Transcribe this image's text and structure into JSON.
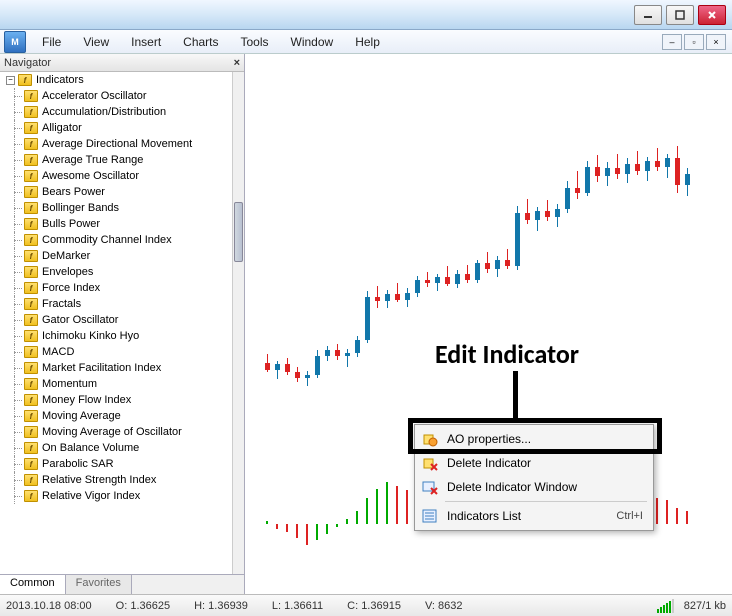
{
  "menu": {
    "file": "File",
    "view": "View",
    "insert": "Insert",
    "charts": "Charts",
    "tools": "Tools",
    "window": "Window",
    "help": "Help"
  },
  "navigator": {
    "title": "Navigator",
    "root": "Indicators",
    "items": [
      "Accelerator Oscillator",
      "Accumulation/Distribution",
      "Alligator",
      "Average Directional Movement",
      "Average True Range",
      "Awesome Oscillator",
      "Bears Power",
      "Bollinger Bands",
      "Bulls Power",
      "Commodity Channel Index",
      "DeMarker",
      "Envelopes",
      "Force Index",
      "Fractals",
      "Gator Oscillator",
      "Ichimoku Kinko Hyo",
      "MACD",
      "Market Facilitation Index",
      "Momentum",
      "Money Flow Index",
      "Moving Average",
      "Moving Average of Oscillator",
      "On Balance Volume",
      "Parabolic SAR",
      "Relative Strength Index",
      "Relative Vigor Index"
    ],
    "tabs": {
      "common": "Common",
      "favorites": "Favorites"
    }
  },
  "context_menu": {
    "properties": "AO properties...",
    "delete_ind": "Delete Indicator",
    "delete_win": "Delete Indicator Window",
    "list": "Indicators List",
    "list_shortcut": "Ctrl+I"
  },
  "annotation": "Edit Indicator",
  "status": {
    "datetime": "2013.10.18 08:00",
    "open_label": "O:",
    "open": "1.36625",
    "high_label": "H:",
    "high": "1.36939",
    "low_label": "L:",
    "low": "1.36611",
    "close_label": "C:",
    "close": "1.36915",
    "vol_label": "V:",
    "vol": "8632",
    "traffic": "827/1 kb"
  },
  "chart_data": {
    "type": "candlestick",
    "title": "",
    "indicator_subwindow": "Awesome Oscillator",
    "candles": [
      {
        "x": 0,
        "o": 1,
        "h": 7,
        "l": -6,
        "c": -4,
        "dir": "r"
      },
      {
        "x": 1,
        "o": -4,
        "h": 2,
        "l": -11,
        "c": 0,
        "dir": "b"
      },
      {
        "x": 2,
        "o": 0,
        "h": 4,
        "l": -8,
        "c": -6,
        "dir": "r"
      },
      {
        "x": 3,
        "o": -6,
        "h": -2,
        "l": -13,
        "c": -10,
        "dir": "r"
      },
      {
        "x": 4,
        "o": -10,
        "h": -5,
        "l": -16,
        "c": -8,
        "dir": "b"
      },
      {
        "x": 5,
        "o": -8,
        "h": 10,
        "l": -10,
        "c": 6,
        "dir": "b"
      },
      {
        "x": 6,
        "o": 6,
        "h": 13,
        "l": 2,
        "c": 10,
        "dir": "b"
      },
      {
        "x": 7,
        "o": 10,
        "h": 14,
        "l": 3,
        "c": 6,
        "dir": "r"
      },
      {
        "x": 8,
        "o": 6,
        "h": 11,
        "l": -2,
        "c": 8,
        "dir": "b"
      },
      {
        "x": 9,
        "o": 8,
        "h": 20,
        "l": 5,
        "c": 17,
        "dir": "b"
      },
      {
        "x": 10,
        "o": 17,
        "h": 52,
        "l": 15,
        "c": 48,
        "dir": "b"
      },
      {
        "x": 11,
        "o": 48,
        "h": 56,
        "l": 40,
        "c": 45,
        "dir": "r"
      },
      {
        "x": 12,
        "o": 45,
        "h": 53,
        "l": 40,
        "c": 50,
        "dir": "b"
      },
      {
        "x": 13,
        "o": 50,
        "h": 58,
        "l": 44,
        "c": 46,
        "dir": "r"
      },
      {
        "x": 14,
        "o": 46,
        "h": 54,
        "l": 41,
        "c": 51,
        "dir": "b"
      },
      {
        "x": 15,
        "o": 51,
        "h": 63,
        "l": 48,
        "c": 60,
        "dir": "b"
      },
      {
        "x": 16,
        "o": 60,
        "h": 66,
        "l": 55,
        "c": 58,
        "dir": "r"
      },
      {
        "x": 17,
        "o": 58,
        "h": 64,
        "l": 52,
        "c": 62,
        "dir": "b"
      },
      {
        "x": 18,
        "o": 62,
        "h": 70,
        "l": 56,
        "c": 57,
        "dir": "r"
      },
      {
        "x": 19,
        "o": 57,
        "h": 67,
        "l": 54,
        "c": 64,
        "dir": "b"
      },
      {
        "x": 20,
        "o": 64,
        "h": 71,
        "l": 58,
        "c": 60,
        "dir": "r"
      },
      {
        "x": 21,
        "o": 60,
        "h": 74,
        "l": 58,
        "c": 72,
        "dir": "b"
      },
      {
        "x": 22,
        "o": 72,
        "h": 80,
        "l": 65,
        "c": 68,
        "dir": "r"
      },
      {
        "x": 23,
        "o": 68,
        "h": 77,
        "l": 62,
        "c": 74,
        "dir": "b"
      },
      {
        "x": 24,
        "o": 74,
        "h": 82,
        "l": 68,
        "c": 70,
        "dir": "r"
      },
      {
        "x": 25,
        "o": 70,
        "h": 113,
        "l": 67,
        "c": 108,
        "dir": "b"
      },
      {
        "x": 26,
        "o": 108,
        "h": 118,
        "l": 100,
        "c": 103,
        "dir": "r"
      },
      {
        "x": 27,
        "o": 103,
        "h": 112,
        "l": 95,
        "c": 109,
        "dir": "b"
      },
      {
        "x": 28,
        "o": 109,
        "h": 117,
        "l": 102,
        "c": 105,
        "dir": "r"
      },
      {
        "x": 29,
        "o": 105,
        "h": 114,
        "l": 98,
        "c": 111,
        "dir": "b"
      },
      {
        "x": 30,
        "o": 111,
        "h": 131,
        "l": 108,
        "c": 126,
        "dir": "b"
      },
      {
        "x": 31,
        "o": 126,
        "h": 138,
        "l": 118,
        "c": 122,
        "dir": "r"
      },
      {
        "x": 32,
        "o": 122,
        "h": 145,
        "l": 120,
        "c": 141,
        "dir": "b"
      },
      {
        "x": 33,
        "o": 141,
        "h": 149,
        "l": 130,
        "c": 134,
        "dir": "r"
      },
      {
        "x": 34,
        "o": 134,
        "h": 144,
        "l": 127,
        "c": 140,
        "dir": "b"
      },
      {
        "x": 35,
        "o": 140,
        "h": 150,
        "l": 132,
        "c": 136,
        "dir": "r"
      },
      {
        "x": 36,
        "o": 136,
        "h": 147,
        "l": 129,
        "c": 143,
        "dir": "b"
      },
      {
        "x": 37,
        "o": 143,
        "h": 152,
        "l": 135,
        "c": 138,
        "dir": "r"
      },
      {
        "x": 38,
        "o": 138,
        "h": 148,
        "l": 131,
        "c": 145,
        "dir": "b"
      },
      {
        "x": 39,
        "o": 145,
        "h": 154,
        "l": 138,
        "c": 141,
        "dir": "r"
      },
      {
        "x": 40,
        "o": 141,
        "h": 150,
        "l": 133,
        "c": 147,
        "dir": "b"
      },
      {
        "x": 41,
        "o": 147,
        "h": 156,
        "l": 122,
        "c": 128,
        "dir": "r"
      },
      {
        "x": 42,
        "o": 128,
        "h": 140,
        "l": 120,
        "c": 136,
        "dir": "b"
      }
    ],
    "ao": [
      {
        "x": 0,
        "v": 2,
        "c": "g"
      },
      {
        "x": 1,
        "v": -3,
        "c": "r"
      },
      {
        "x": 2,
        "v": -5,
        "c": "r"
      },
      {
        "x": 3,
        "v": -9,
        "c": "r"
      },
      {
        "x": 4,
        "v": -13,
        "c": "r"
      },
      {
        "x": 5,
        "v": -10,
        "c": "g"
      },
      {
        "x": 6,
        "v": -6,
        "c": "g"
      },
      {
        "x": 7,
        "v": -2,
        "c": "g"
      },
      {
        "x": 8,
        "v": 3,
        "c": "g"
      },
      {
        "x": 9,
        "v": 8,
        "c": "g"
      },
      {
        "x": 10,
        "v": 16,
        "c": "g"
      },
      {
        "x": 11,
        "v": 22,
        "c": "g"
      },
      {
        "x": 12,
        "v": 26,
        "c": "g"
      },
      {
        "x": 13,
        "v": 24,
        "c": "r"
      },
      {
        "x": 14,
        "v": 21,
        "c": "r"
      },
      {
        "x": 15,
        "v": 19,
        "c": "r"
      },
      {
        "x": 16,
        "v": 16,
        "c": "r"
      },
      {
        "x": 17,
        "v": 13,
        "c": "r"
      },
      {
        "x": 18,
        "v": 10,
        "c": "r"
      },
      {
        "x": 19,
        "v": 8,
        "c": "r"
      },
      {
        "x": 20,
        "v": 6,
        "c": "r"
      },
      {
        "x": 21,
        "v": 8,
        "c": "g"
      },
      {
        "x": 22,
        "v": 10,
        "c": "g"
      },
      {
        "x": 23,
        "v": 12,
        "c": "g"
      },
      {
        "x": 24,
        "v": 11,
        "c": "r"
      },
      {
        "x": 25,
        "v": 18,
        "c": "g"
      },
      {
        "x": 26,
        "v": 22,
        "c": "g"
      },
      {
        "x": 27,
        "v": 23,
        "c": "g"
      },
      {
        "x": 28,
        "v": 20,
        "c": "r"
      },
      {
        "x": 29,
        "v": 18,
        "c": "r"
      },
      {
        "x": 30,
        "v": 22,
        "c": "g"
      },
      {
        "x": 31,
        "v": 26,
        "c": "g"
      },
      {
        "x": 32,
        "v": 30,
        "c": "g"
      },
      {
        "x": 33,
        "v": 28,
        "c": "r"
      },
      {
        "x": 34,
        "v": 25,
        "c": "r"
      },
      {
        "x": 35,
        "v": 22,
        "c": "r"
      },
      {
        "x": 36,
        "v": 20,
        "c": "r"
      },
      {
        "x": 37,
        "v": 18,
        "c": "r"
      },
      {
        "x": 38,
        "v": 17,
        "c": "r"
      },
      {
        "x": 39,
        "v": 16,
        "c": "r"
      },
      {
        "x": 40,
        "v": 15,
        "c": "r"
      },
      {
        "x": 41,
        "v": 10,
        "c": "r"
      },
      {
        "x": 42,
        "v": 8,
        "c": "r"
      }
    ]
  }
}
